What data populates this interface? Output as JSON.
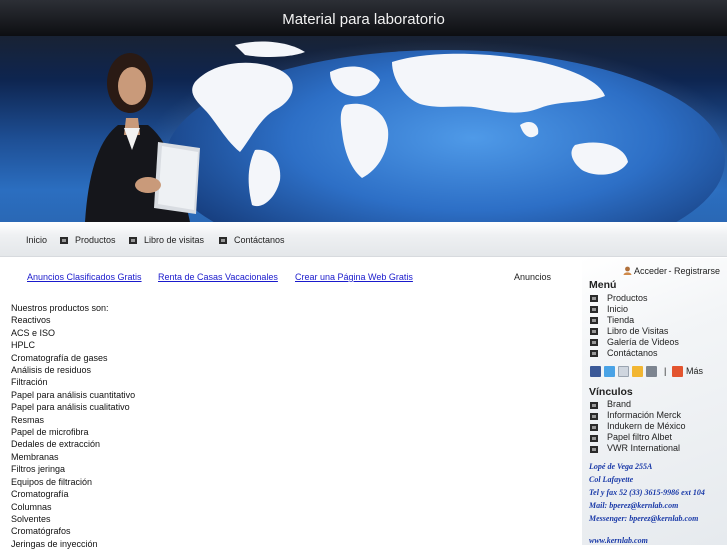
{
  "header": {
    "title": "Material para laboratorio"
  },
  "nav": {
    "items": [
      "Inicio",
      "Productos",
      "Libro de visitas",
      "Contáctanos"
    ]
  },
  "ads": {
    "links": [
      "Anuncios Clasificados Gratis",
      "Renta de Casas Vacacionales",
      "Crear una Página Web Gratis"
    ],
    "label": "Anuncios"
  },
  "products": {
    "intro": "Nuestros productos son:",
    "items": [
      "Reactivos",
      "ACS e ISO",
      "HPLC",
      "Cromatografía de gases",
      "Análisis de residuos",
      "Filtración",
      "Papel para análisis cuantitativo",
      "Papel para análisis cualitativo",
      "Resmas",
      "Papel de microfibra",
      "Dedales de extracción",
      "Membranas",
      "Filtros jeringa",
      "Equipos de filtración",
      "Cromatografía",
      "Columnas",
      "Solventes",
      "Cromatógrafos",
      "Jeringas de inyección"
    ]
  },
  "sidebar": {
    "login": "Acceder",
    "separator": " - ",
    "register": "Registrarse",
    "menu_title": "Menú",
    "menu": [
      "Productos",
      "Inicio",
      "Tienda",
      "Libro de Visitas",
      "Galería de Videos",
      "Contáctanos"
    ],
    "share_pipe": "|",
    "share_more": "Más",
    "links_title": "Vínculos",
    "links": [
      "Brand",
      "Información Merck",
      "Indukern de México",
      "Papel filtro Albet",
      "VWR International"
    ],
    "contact": [
      "Lopé de Vega 255A",
      "Col Lafayette",
      "Tel y fax 52 (33) 3615-9986 ext 104",
      "Mail: bperez@kernlab.com",
      "Messenger: bperez@kernlab.com"
    ],
    "website": "www.kernlab.com"
  },
  "colors": {
    "link": "#1a1acc",
    "contact": "#1a3aa8",
    "banner_blue": "#2b6ec0"
  }
}
